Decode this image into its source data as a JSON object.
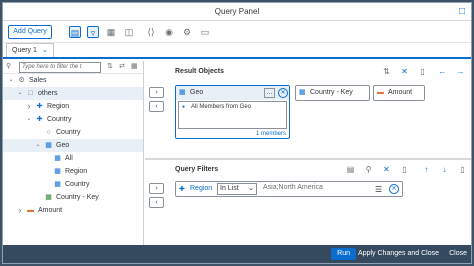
{
  "dialog": {
    "title": "Query Panel"
  },
  "toolbar": {
    "add_query_label": "Add Query",
    "icons": [
      "layout-icon",
      "filter-icon",
      "hierarchy-icon",
      "view-icon",
      "script-icon",
      "properties-icon",
      "settings-icon",
      "clipboard-icon"
    ]
  },
  "tabs": [
    {
      "label": "Query 1"
    }
  ],
  "search": {
    "placeholder": "Type here to filter the t"
  },
  "tree": [
    {
      "label": "Sales",
      "level": 0,
      "expand": "expanded",
      "icon": "universe-icon"
    },
    {
      "label": "others",
      "level": 1,
      "expand": "expanded",
      "icon": "folder-icon",
      "selected": true
    },
    {
      "label": "Region",
      "level": 2,
      "expand": "collapsed",
      "icon": "dimension-icon"
    },
    {
      "label": "Country",
      "level": 2,
      "expand": "expanded",
      "icon": "dimension-icon"
    },
    {
      "label": "Country",
      "level": 3,
      "expand": "",
      "icon": "attribute-icon"
    },
    {
      "label": "Geo",
      "level": 3,
      "expand": "expanded",
      "icon": "hierarchy-icon",
      "selected": true
    },
    {
      "label": "All",
      "level": 4,
      "expand": "",
      "icon": "level-icon"
    },
    {
      "label": "Region",
      "level": 4,
      "expand": "",
      "icon": "level-icon"
    },
    {
      "label": "Country",
      "level": 4,
      "expand": "",
      "icon": "level-icon"
    },
    {
      "label": "Country - Key",
      "level": 3,
      "expand": "",
      "icon": "key-icon"
    },
    {
      "label": "Amount",
      "level": 1,
      "expand": "collapsed",
      "icon": "measure-icon"
    }
  ],
  "result_objects": {
    "title": "Result Objects",
    "geo_card": {
      "label": "Geo",
      "member_selection": "All Members from Geo",
      "count": "1 members"
    },
    "chips": [
      {
        "label": "Country - Key",
        "icon": "key-icon"
      },
      {
        "label": "Amount",
        "icon": "measure-icon"
      }
    ]
  },
  "query_filters": {
    "title": "Query Filters",
    "filter": {
      "object": "Region",
      "operator": "In List",
      "value": "Asia;North America"
    }
  },
  "footer": {
    "run_label": "Run",
    "apply_label": "Apply Changes and Close",
    "close_label": "Close"
  }
}
